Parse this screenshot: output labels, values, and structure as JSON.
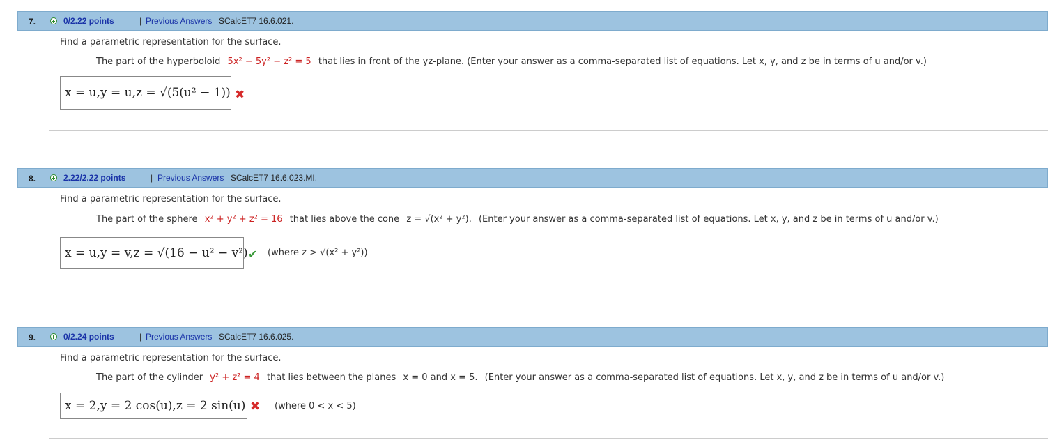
{
  "questions": [
    {
      "number": "7.",
      "points": "0/2.22 points",
      "separator": "|",
      "previous": "Previous Answers",
      "code": "SCalcET7 16.6.021.",
      "instruction": "Find a parametric representation for the surface.",
      "statement_pre": "The part of the hyperboloid",
      "statement_math": "5x² − 5y² − z² = 5",
      "statement_post": "that lies in front of the yz-plane. (Enter your answer as a comma-separated list of equations. Let x, y, and z be in terms of u and/or v.)",
      "answer": "x = u,y = u,z = √(5(u² − 1))",
      "result": "incorrect"
    },
    {
      "number": "8.",
      "points": "2.22/2.22 points",
      "separator": "|",
      "previous": "Previous Answers",
      "code": "SCalcET7 16.6.023.MI.",
      "instruction": "Find a parametric representation for the surface.",
      "statement_pre": "The part of the sphere",
      "statement_math": "x² + y² + z² = 16",
      "statement_mid": "that lies above the cone",
      "statement_math2": "z = √(x² + y²).",
      "statement_post": "(Enter your answer as a comma-separated list of equations. Let x, y, and z be in terms of u and/or v.)",
      "answer": "x = u,y = v,z = √(16 − u² − v²)",
      "result": "correct",
      "hint": "(where z > √(x² + y²))"
    },
    {
      "number": "9.",
      "points": "0/2.24 points",
      "separator": "|",
      "previous": "Previous Answers",
      "code": "SCalcET7 16.6.025.",
      "instruction": "Find a parametric representation for the surface.",
      "statement_pre": "The part of the cylinder",
      "statement_math": "y² + z² = 4",
      "statement_mid": "that lies between the planes",
      "statement_math2": "x = 0 and x = 5.",
      "statement_post": "(Enter your answer as a comma-separated list of equations. Let x, y, and z be in terms of u and/or v.)",
      "answer": "x = 2,y = 2 cos(u),z = 2 sin(u)",
      "result": "incorrect",
      "hint": "(where 0 < x < 5)"
    }
  ],
  "colors": {
    "header_bg": "#9dc3e0",
    "link": "#1a33a8",
    "incorrect": "#d62a2a",
    "correct": "#3a9a3a",
    "highlight": "#cc2222"
  }
}
